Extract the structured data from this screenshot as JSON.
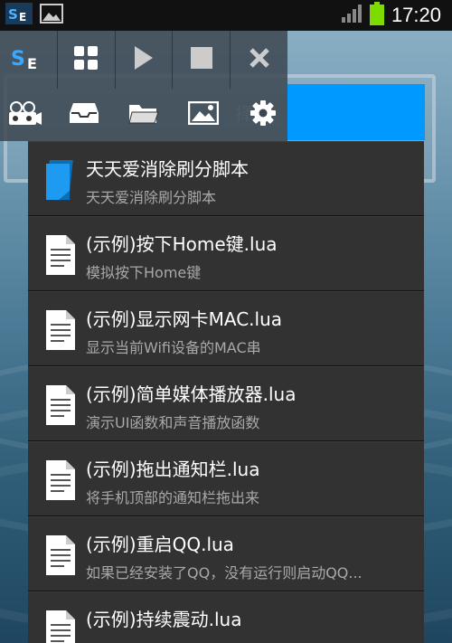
{
  "status_bar": {
    "time": "17:20",
    "icons": [
      "se-app-icon",
      "image-icon",
      "signal-icon",
      "battery-icon"
    ]
  },
  "toolbar": {
    "buttons": [
      "se-logo-icon",
      "grid-icon",
      "play-icon",
      "stop-icon",
      "close-icon"
    ],
    "secondary": [
      "record-icon",
      "inbox-icon",
      "folder-icon",
      "image-icon",
      "gear-icon"
    ]
  },
  "background": {
    "partial_text": "择脚"
  },
  "scripts": [
    {
      "title": "天天爱消除刷分脚本",
      "subtitle": "天天爱消除刷分脚本",
      "icon": "blue-file-icon"
    },
    {
      "title": "(示例)按下Home键.lua",
      "subtitle": "模拟按下Home键",
      "icon": "document-icon"
    },
    {
      "title": "(示例)显示网卡MAC.lua",
      "subtitle": "显示当前Wifi设备的MAC串",
      "icon": "document-icon"
    },
    {
      "title": "(示例)简单媒体播放器.lua",
      "subtitle": "演示UI函数和声音播放函数",
      "icon": "document-icon"
    },
    {
      "title": "(示例)拖出通知栏.lua",
      "subtitle": "将手机顶部的通知栏拖出来",
      "icon": "document-icon"
    },
    {
      "title": "(示例)重启QQ.lua",
      "subtitle": "如果已经安装了QQ，没有运行则启动QQ...",
      "icon": "document-icon"
    },
    {
      "title": "(示例)持续震动.lua",
      "subtitle": "",
      "icon": "document-icon"
    }
  ],
  "colors": {
    "accent_blue": "#0099ff",
    "list_bg": "#323232"
  }
}
